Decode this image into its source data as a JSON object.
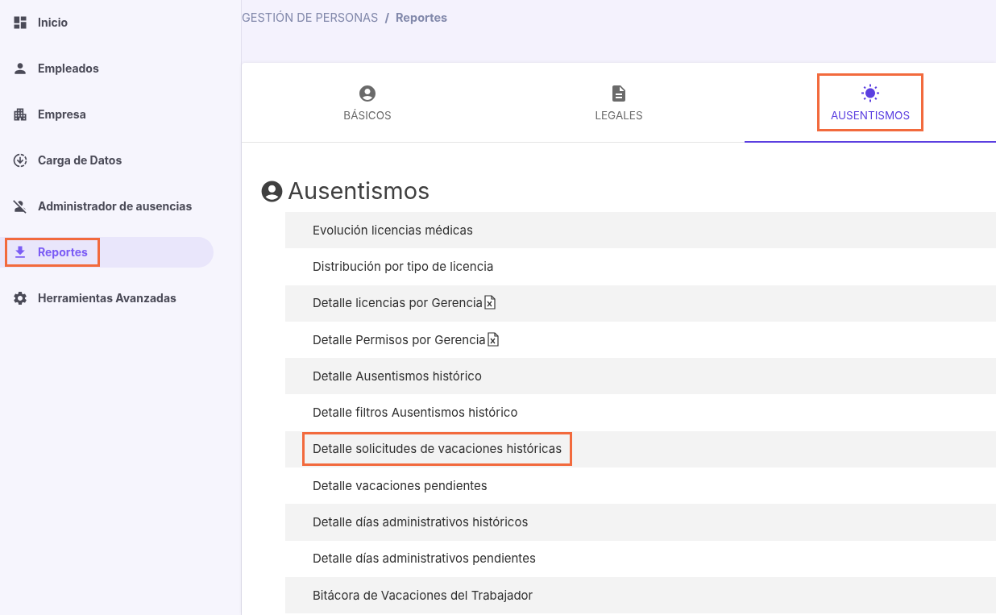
{
  "sidebar": {
    "items": [
      {
        "label": "Inicio",
        "selected": false,
        "highlighted": false
      },
      {
        "label": "Empleados",
        "selected": false,
        "highlighted": false
      },
      {
        "label": "Empresa",
        "selected": false,
        "highlighted": false
      },
      {
        "label": "Carga de Datos",
        "selected": false,
        "highlighted": false
      },
      {
        "label": "Administrador de ausencias",
        "selected": false,
        "highlighted": false
      },
      {
        "label": "Reportes",
        "selected": true,
        "highlighted": true
      },
      {
        "label": "Herramientas Avanzadas",
        "selected": false,
        "highlighted": false
      }
    ]
  },
  "breadcrumb": {
    "section": "GESTIÓN DE PERSONAS",
    "separator": "/",
    "current": "Reportes"
  },
  "tabs": [
    {
      "label": "BÁSICOS",
      "selected": false,
      "highlighted": false
    },
    {
      "label": "LEGALES",
      "selected": false,
      "highlighted": false
    },
    {
      "label": "AUSENTISMOS",
      "selected": true,
      "highlighted": true
    }
  ],
  "heading": "Ausentismos",
  "reports": [
    {
      "label": "Evolución licencias médicas",
      "kind": "plain",
      "highlighted": false
    },
    {
      "label": "Distribución por tipo de licencia",
      "kind": "plain",
      "highlighted": false
    },
    {
      "label": "Detalle licencias por Gerencia",
      "kind": "excel",
      "highlighted": false
    },
    {
      "label": "Detalle Permisos por Gerencia",
      "kind": "excel",
      "highlighted": false
    },
    {
      "label": "Detalle Ausentismos histórico",
      "kind": "plain",
      "highlighted": false
    },
    {
      "label": "Detalle filtros Ausentismos histórico",
      "kind": "plain",
      "highlighted": false
    },
    {
      "label": "Detalle solicitudes de vacaciones históricas",
      "kind": "plain",
      "highlighted": true
    },
    {
      "label": "Detalle vacaciones pendientes",
      "kind": "plain",
      "highlighted": false
    },
    {
      "label": "Detalle días administrativos históricos",
      "kind": "plain",
      "highlighted": false
    },
    {
      "label": "Detalle días administrativos pendientes",
      "kind": "plain",
      "highlighted": false
    },
    {
      "label": "Bitácora de Vacaciones del Trabajador",
      "kind": "plain",
      "highlighted": false
    }
  ]
}
